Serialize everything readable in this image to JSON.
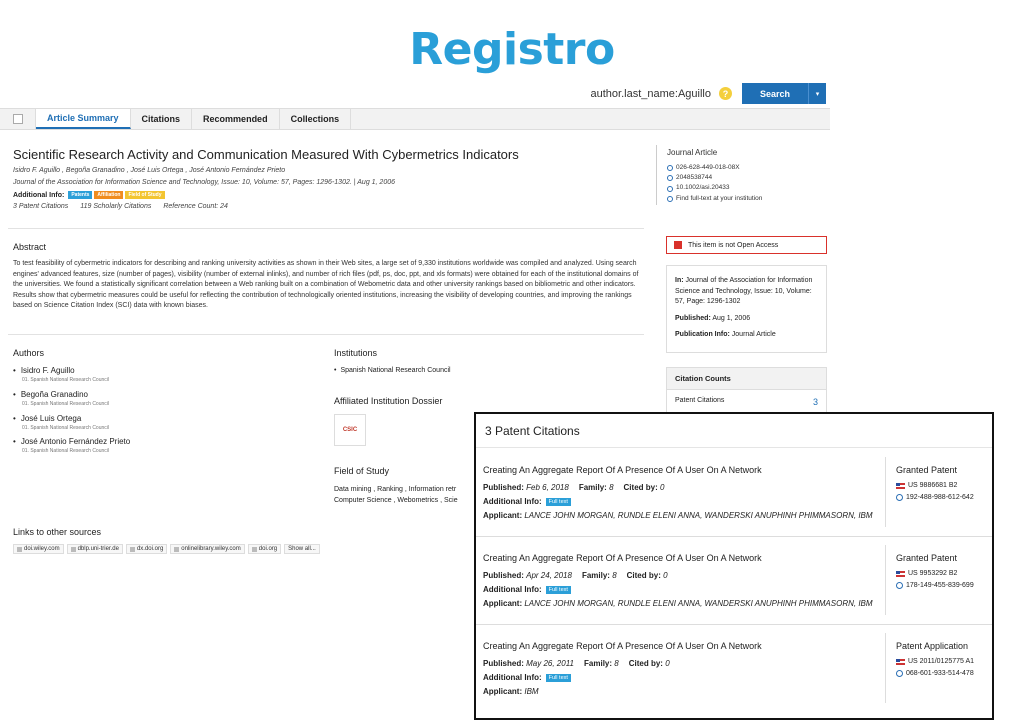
{
  "page_title": "Registro",
  "search": {
    "query": "author.last_name:Aguillo",
    "help": "?",
    "button": "Search",
    "caret": "▾"
  },
  "tabs": [
    "Article Summary",
    "Citations",
    "Recommended",
    "Collections"
  ],
  "article": {
    "title": "Scientific Research Activity and Communication Measured With Cybermetrics Indicators",
    "authors_line": "Isidro F. Aguillo , Begoña Granadino , José Luis Ortega , José Antonio Fernández Prieto",
    "journal_line": "Journal of the Association for Information Science and Technology,  Issue: 10,  Volume: 57,  Pages: 1296-1302.   |  Aug 1, 2006",
    "additional_info_label": "Additional Info:",
    "chips": [
      "Patents",
      "Affiliation",
      "Field of Study"
    ],
    "counts": [
      "3 Patent Citations",
      "119 Scholarly Citations",
      "Reference Count: 24"
    ]
  },
  "side_meta": {
    "type": "Journal Article",
    "ids": [
      "026-628-449-018-08X",
      "2048538744",
      "10.1002/asi.20433",
      "Find full-text at your institution"
    ]
  },
  "abstract": {
    "heading": "Abstract",
    "text": "To test feasibility of cybermetric indicators for describing and ranking university activities as shown in their Web sites, a large set of 9,330 institutions worldwide was compiled and analyzed. Using search engines' advanced features, size (number of pages), visibility (number of external inlinks), and number of rich files (pdf, ps, doc, ppt, and xls formats) were obtained for each of the institutional domains of the universities. We found a statistically significant correlation between a Web ranking built on a combination of Webometric data and other university rankings based on bibliometric and other indicators. Results show that cybermetric measures could be useful for reflecting the contribution of technologically oriented institutions, increasing the visibility of developing countries, and improving the rankings based on Science Citation Index (SCI) data with known biases."
  },
  "authors": {
    "heading": "Authors",
    "items": [
      {
        "name": "Isidro F. Aguillo",
        "aff": "01.  Spanish National Research Council"
      },
      {
        "name": "Begoña Granadino",
        "aff": "01.  Spanish National Research Council"
      },
      {
        "name": "José Luis Ortega",
        "aff": "01.  Spanish National Research Council"
      },
      {
        "name": "José Antonio Fernández Prieto",
        "aff": "01.  Spanish National Research Council"
      }
    ]
  },
  "institutions": {
    "heading": "Institutions",
    "items": [
      "Spanish National Research Council"
    ]
  },
  "dossier": {
    "heading": "Affiliated Institution Dossier",
    "logo_text": "CSIC"
  },
  "field_of_study": {
    "heading": "Field of Study",
    "line1": "Data mining , Ranking , Information retr",
    "line2": "Computer Science , Webometrics , Scie"
  },
  "links": {
    "heading": "Links to other sources",
    "items": [
      "doi.wiley.com",
      "dblp.uni-trier.de",
      "dx.doi.org",
      "onlinelibrary.wiley.com",
      "doi.org",
      "Show all..."
    ]
  },
  "open_access": "This item is not Open Access",
  "pub_box": {
    "in_label": "In:",
    "in_text": "Journal of the Association for Information Science and Technology, Issue: 10, Volume: 57, Page: 1296-1302",
    "published_label": "Published:",
    "published": "Aug 1, 2006",
    "pubinfo_label": "Publication Info:",
    "pubinfo": "Journal Article"
  },
  "citation_counts": {
    "heading": "Citation Counts",
    "label": "Patent Citations",
    "value": "3"
  },
  "popup": {
    "title": "3 Patent Citations",
    "labels": {
      "published": "Published:",
      "family": "Family:",
      "cited_by": "Cited by:",
      "additional": "Additional Info:",
      "fulltext": "Full text",
      "applicant": "Applicant:"
    },
    "rows": [
      {
        "title": "Creating An Aggregate Report Of A Presence Of A User On A Network",
        "published": "Feb 6, 2018",
        "family": "8",
        "cited_by": "0",
        "applicant": "LANCE JOHN MORGAN, RUNDLE ELENI ANNA, WANDERSKI ANUPHINH PHIMMASORN, IBM",
        "type": "Granted Patent",
        "number": "US 9886681 B2",
        "lens": "192-488-988-612-642"
      },
      {
        "title": "Creating An Aggregate Report Of A Presence Of A User On A Network",
        "published": "Apr 24, 2018",
        "family": "8",
        "cited_by": "0",
        "applicant": "LANCE JOHN MORGAN, RUNDLE ELENI ANNA, WANDERSKI ANUPHINH PHIMMASORN, IBM",
        "type": "Granted Patent",
        "number": "US 9953292 B2",
        "lens": "178-149-455-839-699"
      },
      {
        "title": "Creating An Aggregate Report Of A Presence Of A User On A Network",
        "published": "May 26, 2011",
        "family": "8",
        "cited_by": "0",
        "applicant": "IBM",
        "type": "Patent Application",
        "number": "US 2011/0125775 A1",
        "lens": "068-601-933-514-478"
      }
    ]
  }
}
